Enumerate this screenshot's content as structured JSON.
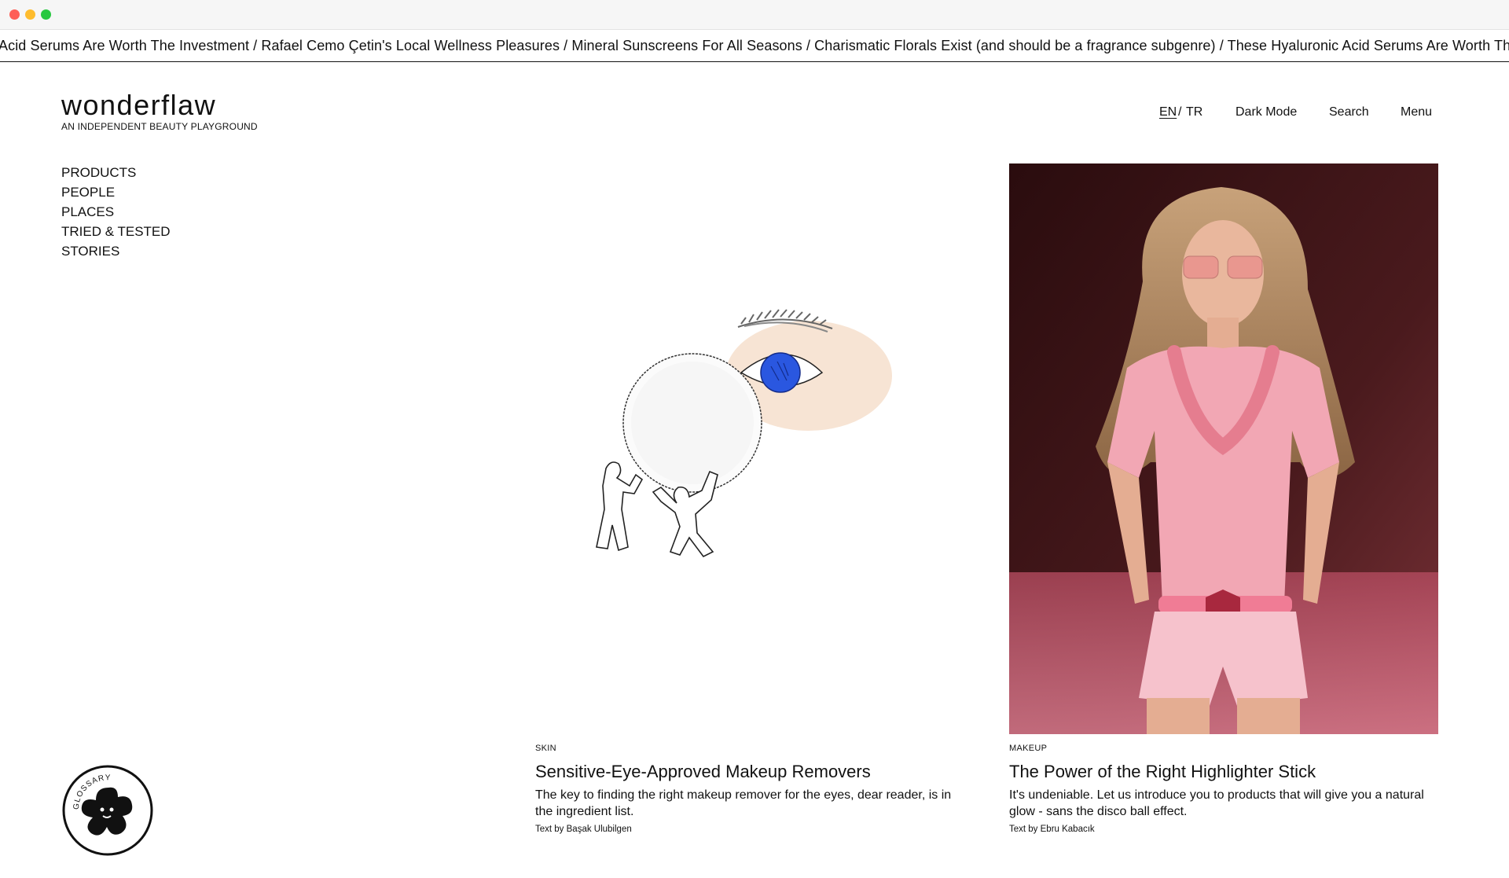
{
  "ticker": "Acid Serums Are Worth The Investment / Rafael Cemo Çetin's Local Wellness Pleasures / Mineral Sunscreens For All Seasons / Charismatic Florals Exist (and should be a fragrance subgenre) / These Hyaluronic Acid Serums Are Worth The Investment /",
  "logo": {
    "name": "wonderflaw",
    "tagline": "AN INDEPENDENT BEAUTY PLAYGROUND"
  },
  "topnav": {
    "lang_en": "EN",
    "lang_sep": "/",
    "lang_tr": "TR",
    "dark_mode": "Dark Mode",
    "search": "Search",
    "menu": "Menu"
  },
  "sidenav": [
    "PRODUCTS",
    "PEOPLE",
    "PLACES",
    "TRIED & TESTED",
    "STORIES"
  ],
  "articles": [
    {
      "category": "SKIN",
      "title": "Sensitive-Eye-Approved Makeup Removers",
      "excerpt": "The key to finding the right makeup remover for the eyes, dear reader, is in the ingredient list.",
      "byline": "Text by Başak Ulubilgen",
      "image": "illustration-eye-cotton-pad"
    },
    {
      "category": "MAKEUP",
      "title": "The Power of the Right Highlighter Stick",
      "excerpt": "It's undeniable. Let us introduce you to products that will give you a natural glow - sans the disco ball effect.",
      "byline": "Text by Ebru Kabacık",
      "image": "runway-model-photo"
    }
  ],
  "glossary": {
    "label": "GLOSSARY"
  },
  "colors": {
    "text": "#111111",
    "eye_skin": "#f7e4d4",
    "iris": "#2a57e0",
    "photo_bg": "#3a1516",
    "photo_pink": "#f2a7b4"
  }
}
